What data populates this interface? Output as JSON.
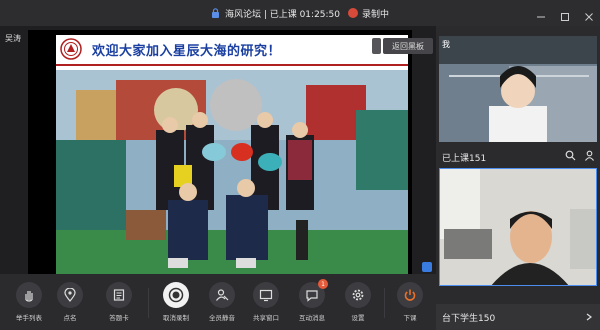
{
  "topbar": {
    "title": "海风论坛 | 已上课 01:25:50",
    "record_label": "录制中"
  },
  "stage": {
    "teacher_name": "吴涛",
    "side_button": "返回黑板",
    "slide_title": "欢迎大家加入星辰大海的研究！"
  },
  "right_panel": {
    "video1_label": "我",
    "video1_name": "已上课151",
    "video2_footer": "台下学生150"
  },
  "toolbar": {
    "items": [
      {
        "label": "举手列表",
        "icon": "hand-icon"
      },
      {
        "label": "点名",
        "icon": "location-pin-icon"
      },
      {
        "label": "答题卡",
        "icon": "answer-card-icon"
      },
      {
        "label": "取消录制",
        "icon": "record-icon"
      },
      {
        "label": "全员静音",
        "icon": "mute-all-icon"
      },
      {
        "label": "共享窗口",
        "icon": "share-window-icon"
      },
      {
        "label": "互动消息",
        "icon": "chat-icon",
        "badge": "1"
      },
      {
        "label": "设置",
        "icon": "settings-icon"
      },
      {
        "label": "下课",
        "icon": "power-icon"
      }
    ]
  },
  "colors": {
    "record_red": "#d84a3a",
    "title_blue": "#1a3fa0",
    "power_orange": "#e8702a",
    "active_border": "#4c8ef0"
  }
}
